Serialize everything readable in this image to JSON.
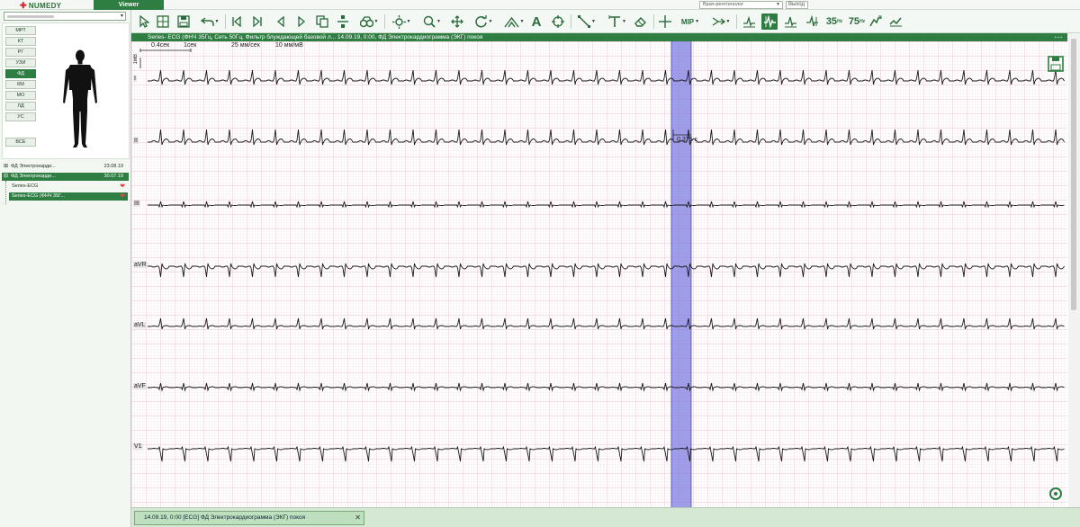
{
  "app": {
    "logo": "NUMEDY",
    "tab": "Viewer"
  },
  "topbar": {
    "role": "Врач-рентгенолог",
    "logout": "Выход"
  },
  "sidebar": {
    "modalities": [
      "МРТ",
      "КТ",
      "РГ",
      "УЗИ",
      "ФД",
      "КМ",
      "МО",
      "ЛД",
      "УС"
    ],
    "active_modality": "ФД",
    "all_button": "ВСЕ",
    "studies": [
      {
        "name": "ФД Электрокарди...",
        "date": "23.08.19",
        "selected": false
      },
      {
        "name": "ФД Электрокарди...",
        "date": "30.07.19",
        "selected": true
      }
    ],
    "series": [
      {
        "name": "Series-ECG",
        "selected": false
      },
      {
        "name": "Series-ECG (ФНЧ 35Г...",
        "selected": true
      }
    ]
  },
  "toolbar": {
    "icons": [
      "pointer-icon",
      "grid-layout-icon",
      "save-icon",
      "undo-icon",
      "first-frame-icon",
      "prev-frame-icon",
      "play-back-icon",
      "play-forward-icon",
      "copy-icon",
      "series-sync-icon",
      "binoculars-icon",
      "brightness-icon",
      "zoom-icon",
      "pan-icon",
      "rotate-icon",
      "filter-icon",
      "text-annotation-icon",
      "crosshair-icon",
      "line-measure-icon",
      "text-tool-icon",
      "eraser-icon",
      "reference-lines-icon",
      "mip-icon",
      "fusion-icon",
      "ecg-baseline-icon",
      "ecg-waveform-icon",
      "ecg-amplitude-icon",
      "ecg-qrs-icon",
      "filter-35hz-icon",
      "filter-75hz-icon",
      "notch-filter-icon",
      "ecg-slope-icon"
    ],
    "mip_label": "MIP",
    "filter_35_label": "35",
    "filter_75_label": "75"
  },
  "viewer": {
    "header": "Series- ECG (ФНЧ 35Гц, Сеть 50Гц, Фильтр блуждающей базовой л... 14.09.19, 0:00, ФД Электрокардиограмма (ЭКГ) покоя",
    "scale_time_1": "0.4сек",
    "scale_time_2": "1сек",
    "speed": "25 мм/сек",
    "gain": "10 мм/мВ",
    "scale_mv": "1мВ",
    "cursor_measurement": "0.375 с",
    "leads": [
      "I",
      "II",
      "III",
      "aVR",
      "aVL",
      "aVF",
      "V1"
    ]
  },
  "bottom": {
    "tab_label": "14.09.19, 0:00 [ECG] ФД Электрокардиограмма (ЭКГ) покоя"
  }
}
